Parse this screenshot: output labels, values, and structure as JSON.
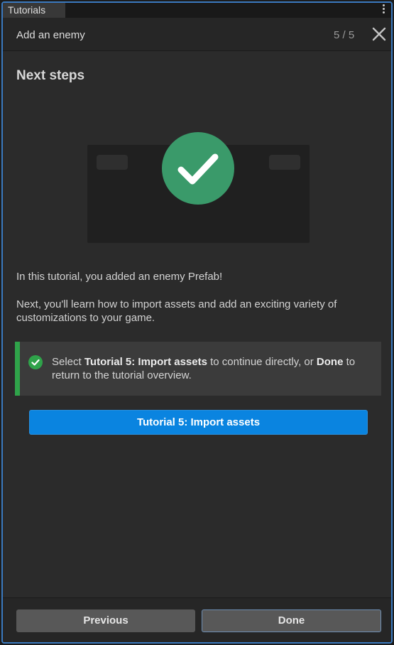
{
  "window": {
    "tab_label": "Tutorials",
    "menu_icon": "kebab-menu-icon"
  },
  "header": {
    "title": "Add an enemy",
    "progress": "5 / 5",
    "close_icon": "close-icon"
  },
  "content": {
    "heading": "Next steps",
    "illustration_icon": "checkmark-circle-icon",
    "paragraph1": "In this tutorial, you added an enemy Prefab!",
    "paragraph2": "Next, you'll learn how to import assets and add an exciting variety of customizations to your game.",
    "callout": {
      "icon": "success-check-icon",
      "text_before": "Select ",
      "bold1": "Tutorial 5: Import assets",
      "text_middle": " to continue directly, or ",
      "bold2": "Done",
      "text_after": " to return to the tutorial overview."
    },
    "primary_button": "Tutorial 5: Import assets"
  },
  "footer": {
    "previous_label": "Previous",
    "done_label": "Done"
  },
  "colors": {
    "accent_blue": "#0a84e0",
    "success_green": "#2fa34a",
    "illustration_green": "#3a9a6a",
    "window_border": "#3a79bf"
  }
}
